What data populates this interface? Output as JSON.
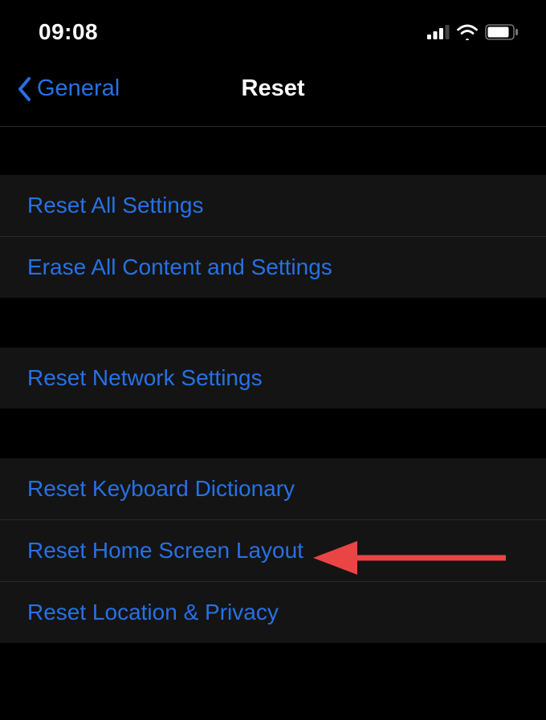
{
  "status_bar": {
    "time": "09:08"
  },
  "nav": {
    "back_label": "General",
    "title": "Reset"
  },
  "sections": [
    {
      "items": [
        {
          "label": "Reset All Settings"
        },
        {
          "label": "Erase All Content and Settings"
        }
      ]
    },
    {
      "items": [
        {
          "label": "Reset Network Settings"
        }
      ]
    },
    {
      "items": [
        {
          "label": "Reset Keyboard Dictionary"
        },
        {
          "label": "Reset Home Screen Layout"
        },
        {
          "label": "Reset Location & Privacy"
        }
      ]
    }
  ]
}
